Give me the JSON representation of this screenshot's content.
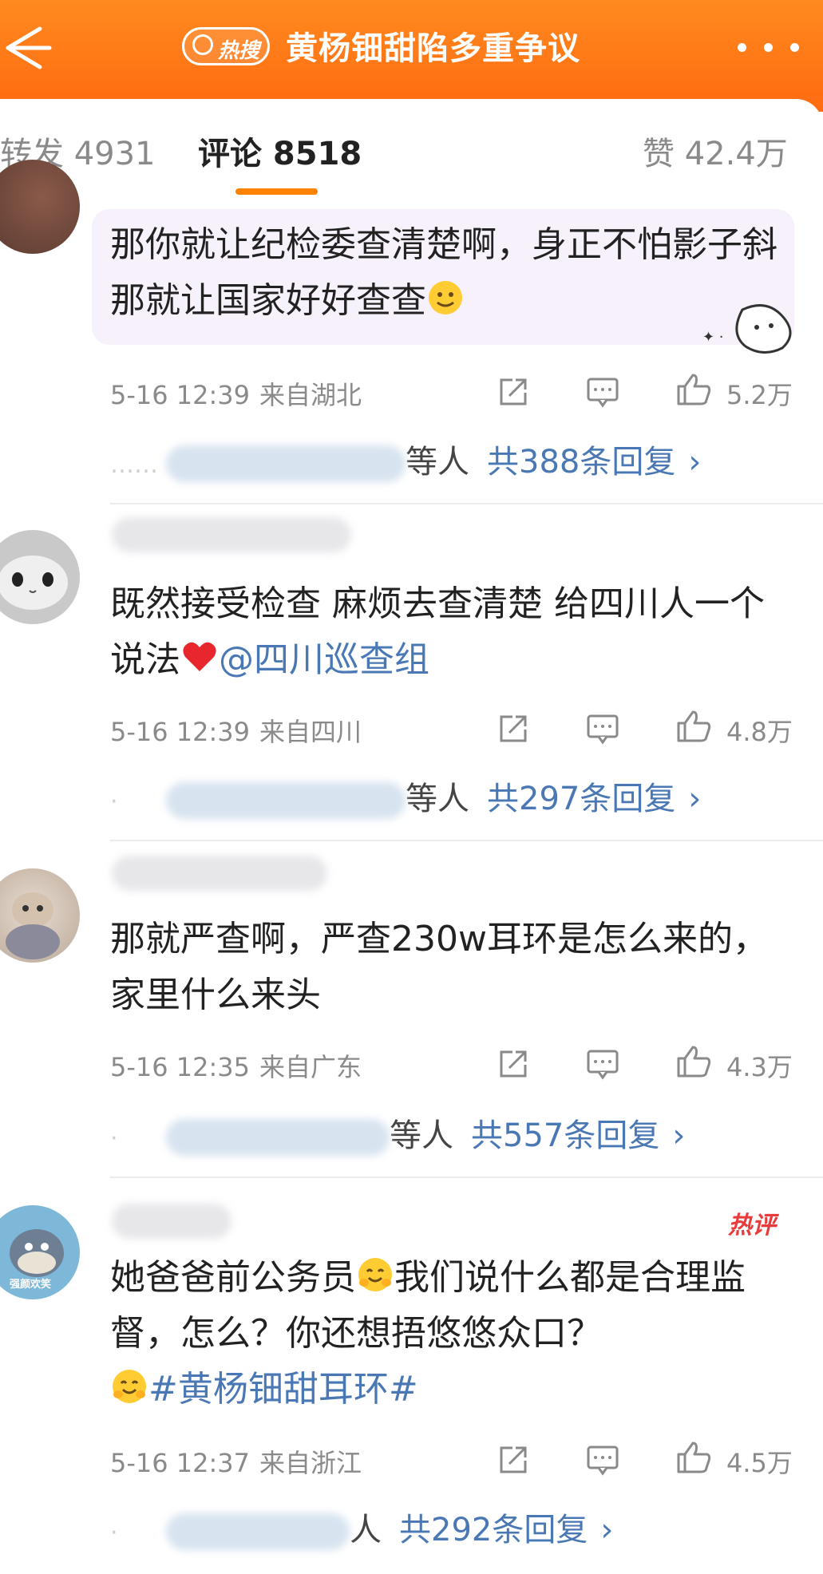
{
  "header": {
    "hot_badge_label": "热搜",
    "title": "黄杨钿甜陷多重争议",
    "more_icon": "more-dots-icon",
    "back_icon": "back-arrow-icon"
  },
  "tabs": {
    "repost": "转发 4931",
    "comments": "评论 8518",
    "likes": "赞 42.4万"
  },
  "colors": {
    "header_orange": "#ff7513",
    "link_blue": "#4a78b4",
    "hot_red": "#e83c3c"
  },
  "comments": [
    {
      "text": "那你就让纪检委查清楚啊，身正不怕影子斜那就让国家好好查查",
      "time": "5-16 12:39",
      "location": "来自湖北",
      "likes": "5.2万",
      "reply_suffix": "等人",
      "reply_total": "共388条回复"
    },
    {
      "text": "既然接受检查  麻烦去查清楚 给四川人一个说法",
      "mention": "@四川巡查组",
      "time": "5-16 12:39",
      "location": "来自四川",
      "likes": "4.8万",
      "reply_suffix": "等人",
      "reply_total": "共297条回复"
    },
    {
      "text": "那就严查啊，严查230w耳环是怎么来的，家里什么来头",
      "time": "5-16 12:35",
      "location": "来自广东",
      "likes": "4.3万",
      "reply_suffix": "等人",
      "reply_total": "共557条回复"
    },
    {
      "hot_label": "热评",
      "text_part1": "她爸爸前公务员",
      "text_part2": "我们说什么都是合理监督，怎么？你还想捂悠悠众口？",
      "hashtag": "#黄杨钿甜耳环#",
      "avatar_caption": "强颜欢笑",
      "time": "5-16 12:37",
      "location": "来自浙江",
      "likes": "4.5万",
      "reply_suffix": "人",
      "reply_total": "共292条回复"
    }
  ],
  "chevron": "›"
}
